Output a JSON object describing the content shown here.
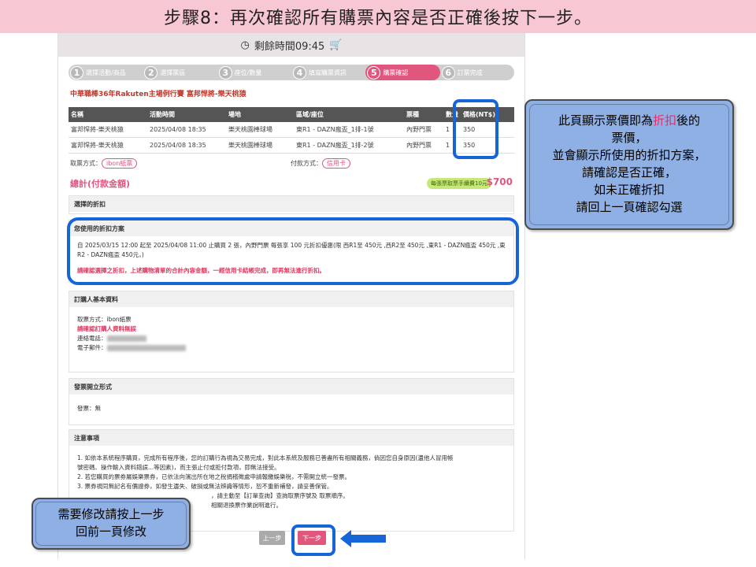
{
  "slide_title": "步驟8：再次確認所有購票內容是否正確後按下一步。",
  "timer": {
    "label": "剩餘時間09:45"
  },
  "steps": [
    {
      "num": "1",
      "label": "選擇活動/商品"
    },
    {
      "num": "2",
      "label": "選擇票區"
    },
    {
      "num": "3",
      "label": "座位/數量"
    },
    {
      "num": "4",
      "label": "填寫購票資訊"
    },
    {
      "num": "5",
      "label": "購票確認"
    },
    {
      "num": "6",
      "label": "訂票完成"
    }
  ],
  "event_title": "中華職棒36年Rakuten主場例行賽 富邦悍將-樂天桃猿",
  "table": {
    "headers": [
      "名稱",
      "活動時間",
      "場地",
      "區域/座位",
      "票種",
      "數量",
      "價格(NT$)"
    ],
    "rows": [
      [
        "富邦悍將-樂天桃猿",
        "2025/04/08 18:35",
        "樂天桃園棒球場",
        "東R1 - DAZN瘋盃_1排-1號",
        "內野門票",
        "1",
        "350"
      ],
      [
        "富邦悍將-樂天桃猿",
        "2025/04/08 18:35",
        "樂天桃園棒球場",
        "東R1 - DAZN瘋盃_1排-2號",
        "內野門票",
        "1",
        "350"
      ]
    ]
  },
  "pickup": {
    "label": "取票方式：",
    "value": "ibon紙票"
  },
  "payment": {
    "label": "付款方式：",
    "value": "信用卡"
  },
  "total": {
    "label": "總計(付款金額)",
    "fee_badge": "每張票取票手續費10元",
    "amount": "$700"
  },
  "discount": {
    "head": "選擇的折扣",
    "plan_head": "您使用的折扣方案",
    "plan_text": "自 2025/03/15 12:00 起至 2025/04/08 11:00 止購買 2 張，內野門票 每張享 100 元折扣優惠(限 西R1至 450元 ,西R2至 450元 ,東R1 - DAZN瘋盃 450元 ,東R2 - DAZN瘋盃 450元，)",
    "warning": "請確認選擇之折扣，上述購物清單的合計內容金額，一經信用卡結帳完成，即再無法進行折扣。"
  },
  "buyer": {
    "head": "訂購人基本資料",
    "pickup_line": "取票方式：ibon紙票",
    "confirm_line": "請確認訂購人資料無誤",
    "phone_label": "連絡電話：",
    "email_label": "電子郵件："
  },
  "invoice": {
    "head": "發票開立形式",
    "value": "發票：無"
  },
  "notice": {
    "head": "注意事項",
    "lines": [
      "1. 如依本系統程序購買，完成所有程序後，您的訂購行為視為交易完成，對此本系統及服務已善盡所有相關義務，倘因您自身原因(遺他人冒用帳",
      "號密碼、操作輸入資料錯誤...等因素)，而主張止付或拒付款項，即無法接受。",
      "2. 若您購買的票券屬娛樂票券，已依法向濱出所在地之稅捐稽徵處申請報繳娛樂稅，不需開立統一發票。",
      "3. 票券視同無記名有價證券，如發生遺失、破損或無法辨識等情形，恕不重新補發，請妥善保管。",
      "，請主動至【訂單查詢】查詢取票序號及 取票順序。",
      "相關退換票作業說明進行。"
    ]
  },
  "buttons": {
    "prev": "上一步",
    "next": "下一步"
  },
  "callout_right": {
    "line1_a": "此頁顯示票價即為",
    "line1_hot": "折扣",
    "line1_b": "後的",
    "line2": "票價，",
    "line3": "並會顯示所使用的折扣方案，",
    "line4": "請確認是否正確，",
    "line5": "如未正確折扣",
    "line6": "請回上一頁確認勾選"
  },
  "callout_left": {
    "line1": "需要修改請按上一步",
    "line2": "回前一頁修改"
  },
  "colors": {
    "accent": "#e0567d",
    "highlight": "#1565d8",
    "callout_bg": "#8fb0e4",
    "title_bg": "#f8c7d4"
  }
}
